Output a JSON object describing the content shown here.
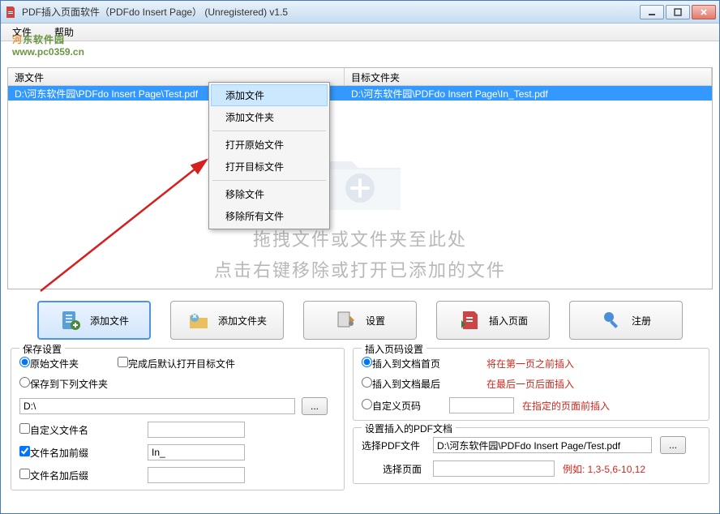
{
  "window": {
    "title": "PDF插入页面软件（PDFdo Insert Page） (Unregistered) v1.5"
  },
  "menubar": {
    "file": "文件",
    "help": "帮助"
  },
  "watermark": {
    "brand_part1": "河",
    "brand_part2": "东软件园",
    "url": "www.pc0359.cn"
  },
  "file_list": {
    "col_source": "源文件",
    "col_target": "目标文件夹",
    "row": {
      "source": "D:\\河东软件园\\PDFdo Insert Page\\Test.pdf",
      "target": "D:\\河东软件园\\PDFdo Insert Page\\In_Test.pdf"
    }
  },
  "drop_hint": {
    "line1": "拖拽文件或文件夹至此处",
    "line2": "点击右键移除或打开已添加的文件"
  },
  "context_menu": {
    "add_file": "添加文件",
    "add_folder": "添加文件夹",
    "open_original": "打开原始文件",
    "open_target": "打开目标文件",
    "remove_file": "移除文件",
    "remove_all": "移除所有文件"
  },
  "toolbar": {
    "add_file": "添加文件",
    "add_folder": "添加文件夹",
    "settings": "设置",
    "insert_page": "插入页面",
    "register": "注册"
  },
  "save_settings": {
    "legend": "保存设置",
    "original_folder": "原始文件夹",
    "save_to_folder": "保存到下列文件夹",
    "open_target_after": "完成后默认打开目标文件",
    "path_value": "D:\\",
    "custom_filename": "自定义文件名",
    "prefix": "文件名加前缀",
    "prefix_value": "In_",
    "suffix": "文件名加后缀"
  },
  "page_settings": {
    "legend": "插入页码设置",
    "to_first": "插入到文档首页",
    "to_first_desc": "将在第一页之前插入",
    "to_last": "插入到文档最后",
    "to_last_desc": "在最后一页后面插入",
    "custom_page": "自定义页码",
    "custom_page_desc": "在指定的页面前插入"
  },
  "pdf_settings": {
    "legend": "设置插入的PDF文档",
    "select_pdf": "选择PDF文件",
    "pdf_path": "D:\\河东软件园\\PDFdo Insert Page/Test.pdf",
    "select_pages": "选择页面",
    "example": "例如: 1,3-5,6-10,12"
  },
  "browse_label": "..."
}
